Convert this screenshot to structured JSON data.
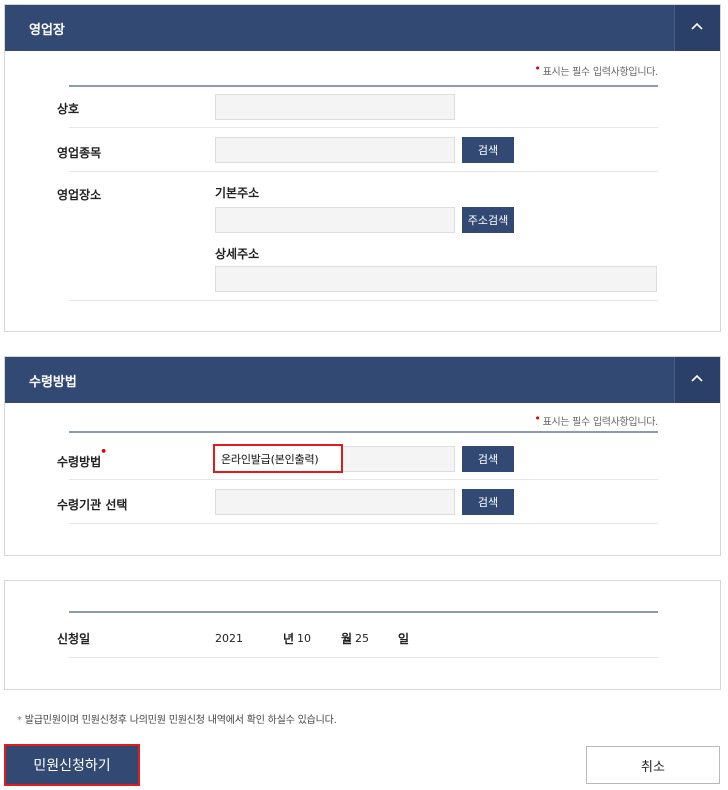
{
  "business_section": {
    "title": "영업장",
    "required_note": "표시는 필수 입력사항입니다.",
    "fields": {
      "trade_name_label": "상호",
      "business_type_label": "영업종목",
      "business_type_search": "검색",
      "location_label": "영업장소",
      "basic_address_label": "기본주소",
      "address_search": "주소검색",
      "detail_address_label": "상세주소"
    }
  },
  "receipt_section": {
    "title": "수령방법",
    "required_note": "표시는 필수 입력사항입니다.",
    "fields": {
      "method_label": "수령방법",
      "method_value": "온라인발급(본인출력)",
      "method_search": "검색",
      "agency_label": "수령기관 선택",
      "agency_search": "검색"
    }
  },
  "date_section": {
    "label": "신청일",
    "year": "2021",
    "year_unit": "년",
    "month": "10",
    "month_unit": "월",
    "day": "25",
    "day_unit": "일"
  },
  "footer": {
    "note": "발급민원이며 민원신청후 나의민원 민원신청 내역에서 확인 하실수 있습니다.",
    "submit_label": "민원신청하기",
    "cancel_label": "취소"
  },
  "colors": {
    "header_bg": "#324a73",
    "highlight": "#e11b1b",
    "required_star": "#e00000"
  }
}
